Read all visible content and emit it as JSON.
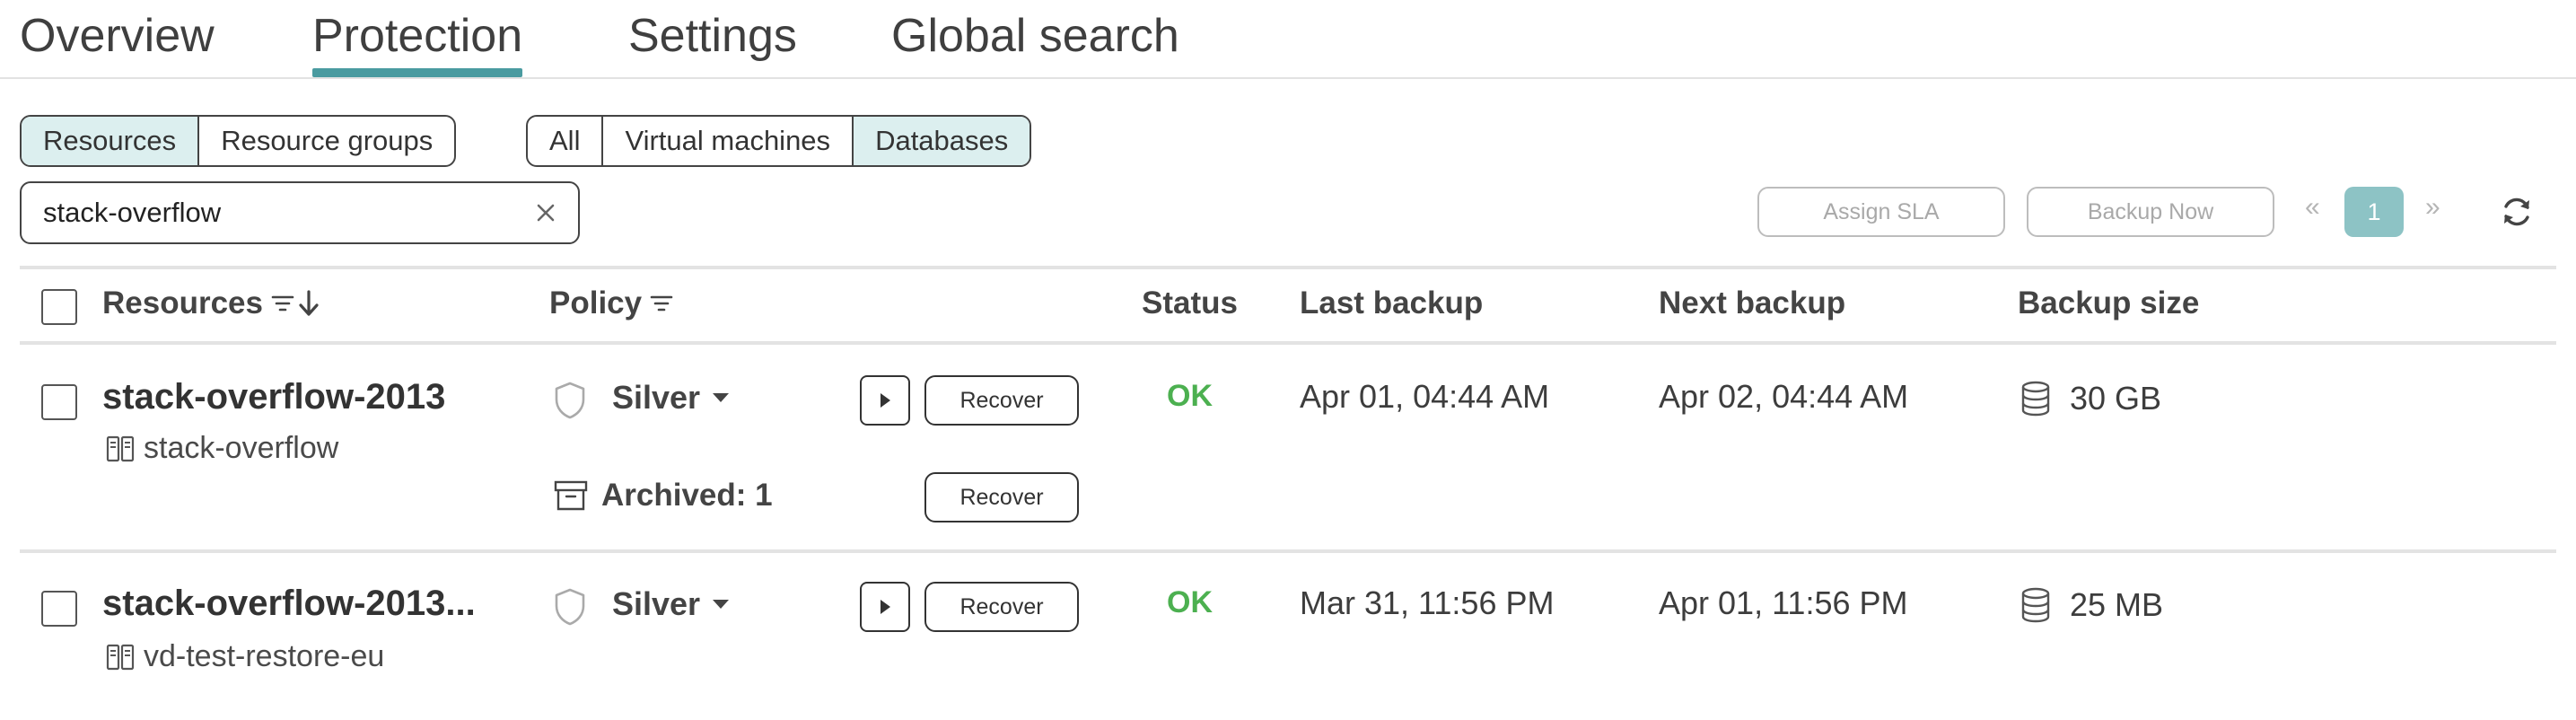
{
  "tabs": [
    {
      "label": "Overview"
    },
    {
      "label": "Protection",
      "active": true
    },
    {
      "label": "Settings"
    },
    {
      "label": "Global search"
    }
  ],
  "view_toggle": {
    "resources": "Resources",
    "resource_groups": "Resource groups",
    "selected": "Resources"
  },
  "type_filter": {
    "all": "All",
    "virtual_machines": "Virtual machines",
    "databases": "Databases",
    "selected": "Databases"
  },
  "search": {
    "value": "stack-overflow"
  },
  "toolbar": {
    "assign_sla": "Assign SLA",
    "backup_now": "Backup Now"
  },
  "pager": {
    "prev": "«",
    "current": "1",
    "next": "»"
  },
  "table": {
    "columns": {
      "resources": "Resources",
      "policy": "Policy",
      "status": "Status",
      "last_backup": "Last backup",
      "next_backup": "Next backup",
      "backup_size": "Backup size"
    },
    "rows": [
      {
        "name": "stack-overflow-2013",
        "subtitle": "stack-overflow",
        "policy": "Silver",
        "recover": "Recover",
        "status": "OK",
        "last_backup": "Apr 01, 04:44 AM",
        "next_backup": "Apr 02, 04:44 AM",
        "size": "30 GB",
        "archived": {
          "label": "Archived: 1",
          "recover": "Recover"
        }
      },
      {
        "name": "stack-overflow-2013...",
        "subtitle": "vd-test-restore-eu",
        "policy": "Silver",
        "recover": "Recover",
        "status": "OK",
        "last_backup": "Mar 31, 11:56 PM",
        "next_backup": "Apr 01, 11:56 PM",
        "size": "25 MB"
      }
    ]
  },
  "colors": {
    "accent": "#4a9ba0",
    "selected_bg": "#dcefef",
    "status_ok": "#4cb050",
    "page_active": "#8dc3c5"
  },
  "icons": {
    "clear": "close-icon",
    "refresh": "refresh-icon",
    "filter": "filter-icon",
    "sort": "sort-down-arrow-icon",
    "policy": "shield-icon",
    "dropdown": "caret-down-icon",
    "play": "play-icon",
    "resource": "database-server-icon",
    "size": "database-icon",
    "archive": "archive-box-icon"
  }
}
